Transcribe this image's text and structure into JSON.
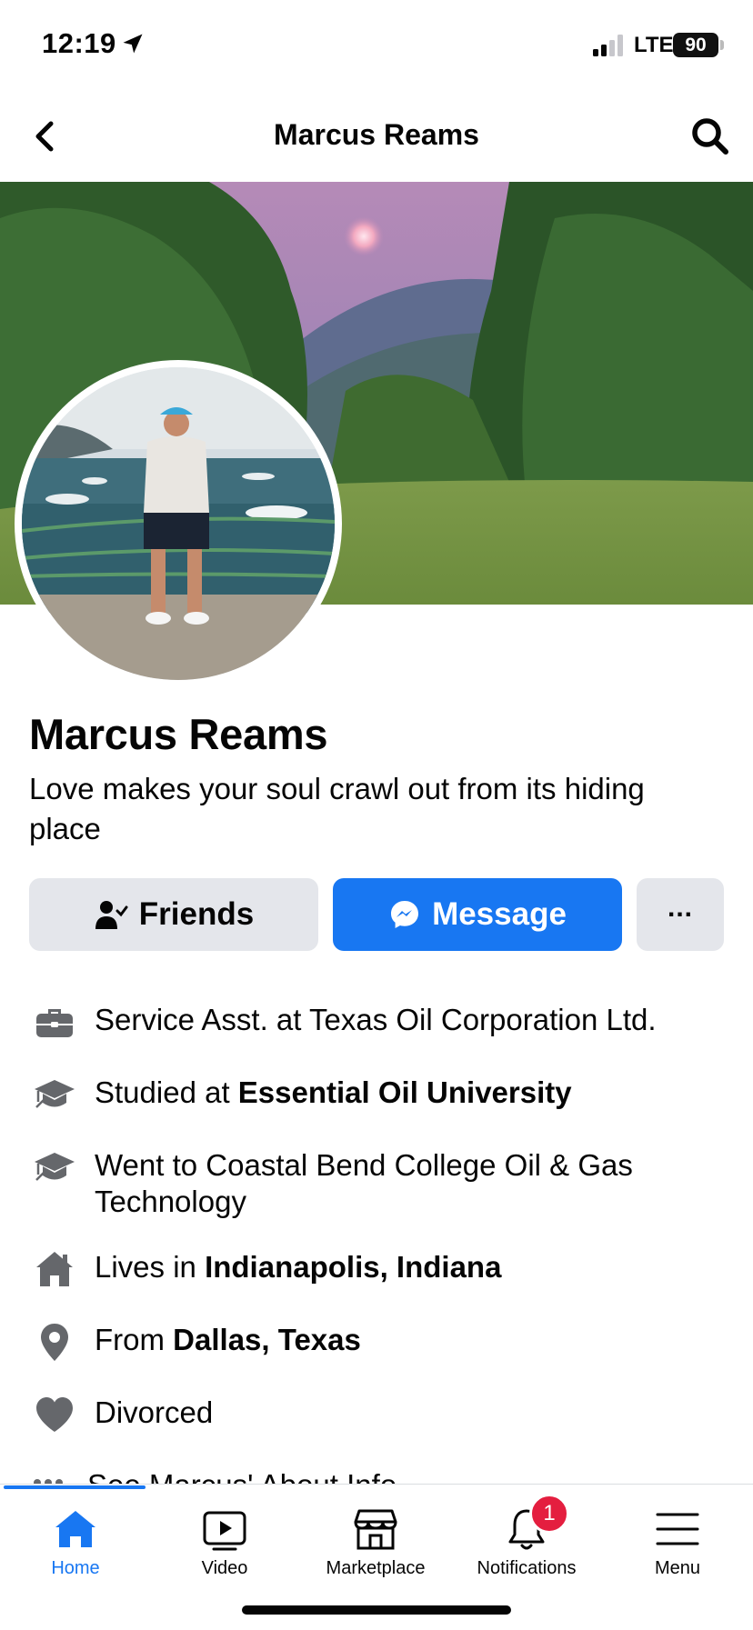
{
  "status_bar": {
    "time": "12:19",
    "network": "LTE",
    "battery": "90"
  },
  "nav": {
    "title": "Marcus Reams",
    "back_icon": "chevron-left-icon",
    "search_icon": "search-icon"
  },
  "profile": {
    "name": "Marcus Reams",
    "bio": "Love makes your soul crawl out from its hiding place"
  },
  "actions": {
    "friends_label": "Friends",
    "message_label": "Message",
    "more_label": "..."
  },
  "about": {
    "work": {
      "text": "Service Asst. at Texas Oil Corporation Ltd.",
      "icon": "briefcase-icon"
    },
    "studied": {
      "prefix": "Studied at ",
      "bold": "Essential Oil University",
      "icon": "graduation-cap-icon"
    },
    "went": {
      "text": "Went to Coastal Bend College Oil & Gas Technology",
      "icon": "graduation-cap-icon"
    },
    "lives": {
      "prefix": "Lives in ",
      "bold": "Indianapolis, Indiana",
      "icon": "house-icon"
    },
    "from": {
      "prefix": "From ",
      "bold": "Dallas, Texas",
      "icon": "location-pin-icon"
    },
    "relationship": {
      "text": "Divorced",
      "icon": "heart-icon"
    },
    "see_more": "See Marcus' About Info"
  },
  "tabbar": {
    "home": "Home",
    "video": "Video",
    "marketplace": "Marketplace",
    "notifications": "Notifications",
    "notifications_badge": "1",
    "menu": "Menu"
  },
  "colors": {
    "accent": "#1877f2",
    "badge": "#e41e3f",
    "button_gray": "#e4e6eb"
  }
}
